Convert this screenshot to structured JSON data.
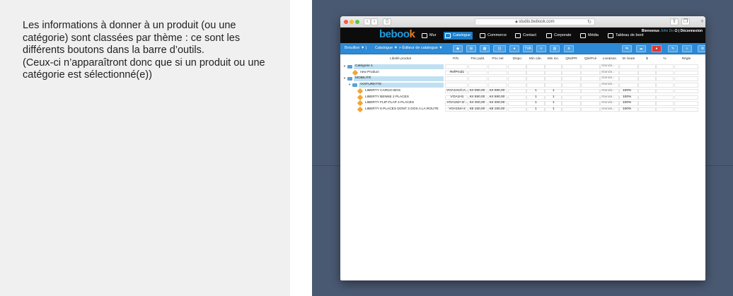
{
  "caption": {
    "line1": "Les informations à donner à un produit (ou une catégorie) sont classées par thème : ce sont les différents boutons dans la barre d’outils.",
    "line2": "(Ceux-ci n’apparaîtront donc que si un produit ou une catégorie est sélectionné(e))"
  },
  "browser": {
    "url": "studio.bebook.com"
  },
  "app": {
    "logo_prefix": "beboo",
    "logo_suffix": "k",
    "nav": [
      "Mur",
      "Catalogue",
      "Commerce",
      "Contact",
      "Corporate",
      "Média",
      "Tableau de bord"
    ],
    "welcome": "Bienvenue",
    "user": "John Do",
    "logout": "Déconnexion"
  },
  "toolbar": {
    "draft": "Brouillon ▼ |",
    "catalog": "Catalogue ▼ > Éditeur de catalogue ▼",
    "icon_label_tva": "TVA"
  },
  "table": {
    "headers": [
      "Libellé produit",
      "P/N",
      "Prix publ.",
      "Prix net",
      "Dispo.",
      "Min cde.",
      "Min inc.",
      "QNI/PR",
      "Qté/Pcé",
      "Livraison",
      "M. brute",
      "$",
      "%",
      "Règle"
    ],
    "rows": [
      {
        "level": 0,
        "kind": "folder",
        "label": "Catégorie 1",
        "pn": "",
        "publ": "",
        "net": "",
        "mincde": "",
        "mininc": "",
        "livraison": "Standa...",
        "marge": "",
        "highlight": true
      },
      {
        "level": 1,
        "kind": "tag",
        "label": "new Product",
        "pn": "RefProd1",
        "publ": "",
        "net": "",
        "mincde": "",
        "mininc": "",
        "livraison": "Standa...",
        "marge": "",
        "highlight": false
      },
      {
        "level": 0,
        "kind": "folder",
        "label": "MOBILITÉ",
        "pn": "",
        "publ": "",
        "net": "",
        "mincde": "",
        "mininc": "",
        "livraison": "Standa...",
        "marge": "",
        "highlight": true
      },
      {
        "level": 1,
        "kind": "folder",
        "label": "VOITURETTE",
        "pn": "",
        "publ": "",
        "net": "",
        "mincde": "",
        "mininc": "",
        "livraison": "Standa...",
        "marge": "",
        "highlight": true
      },
      {
        "level": 2,
        "kind": "tag",
        "label": "LIBERTY CARGO BOX",
        "pn": "VOA1H1/CA...",
        "publ": "€4 080,00",
        "net": "€4 080,00",
        "mincde": "1",
        "mininc": "1",
        "livraison": "Standa...",
        "marge": "100%",
        "highlight": false
      },
      {
        "level": 2,
        "kind": "tag",
        "label": "LIBERTY BENNE 2 PLACES",
        "pn": "VOA1H1",
        "publ": "€4 590,00",
        "net": "€4 590,00",
        "mincde": "1",
        "mininc": "1",
        "livraison": "Standa...",
        "marge": "100%",
        "highlight": false
      },
      {
        "level": 2,
        "kind": "tag",
        "label": "LIBERTY FLIP-FLAP 4 PLACES",
        "pn": "VOA152+2/...",
        "publ": "€4 400,00",
        "net": "€4 400,00",
        "mincde": "1",
        "mininc": "1",
        "livraison": "Standa...",
        "marge": "100%",
        "highlight": false
      },
      {
        "level": 2,
        "kind": "tag",
        "label": "LIBERTY 6 PLACES DONT 2 DOS A LA ROUTE",
        "pn": "VOA154+2",
        "publ": "€5 150,00",
        "net": "€5 150,00",
        "mincde": "1",
        "mininc": "1",
        "livraison": "Standa...",
        "marge": "100%",
        "highlight": false
      }
    ]
  },
  "colors": {
    "accent": "#2c8ad6",
    "header_bg": "#0c0c0c",
    "slide_bg": "#4a5972",
    "highlight_row": "#bfe0f2"
  }
}
